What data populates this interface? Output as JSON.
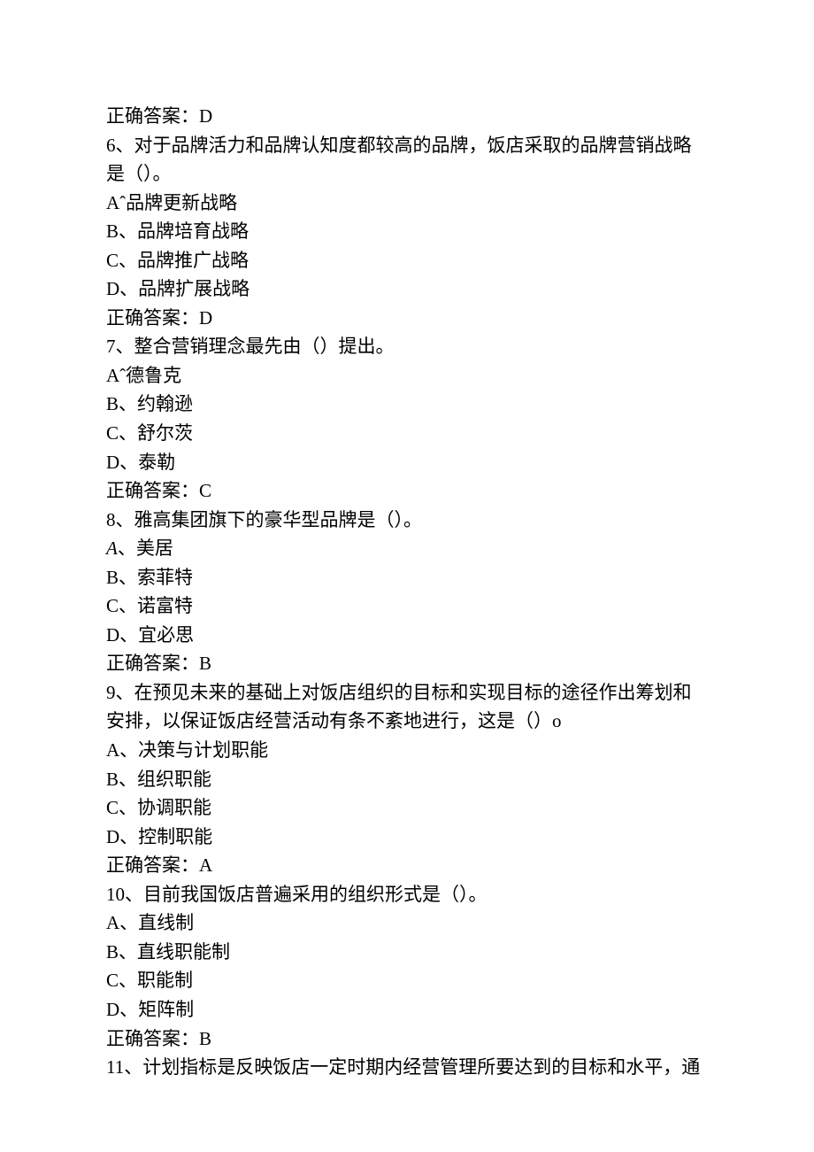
{
  "lines": {
    "l0": "正确答案：D",
    "l1": "6、对于品牌活力和品牌认知度都较高的品牌，饭店采取的品牌营销战略是（）。",
    "l2": "Aˆ品牌更新战略",
    "l3": "B、品牌培育战略",
    "l4": "C、品牌推广战略",
    "l5": "D、品牌扩展战略",
    "l6": "正确答案：D",
    "l7": "7、整合营销理念最先由（）提出。",
    "l8": "Aˆ德鲁克",
    "l9": "B、约翰逊",
    "l10": "C、舒尔茨",
    "l11": "D、泰勒",
    "l12": "正确答案：C",
    "l13": "8、雅高集团旗下的豪华型品牌是（）。",
    "l14a": "A",
    "l14b": "、美居",
    "l15": "B、索菲特",
    "l16": "C、诺富特",
    "l17": "D、宜必思",
    "l18": "正确答案：B",
    "l19": "9、在预见未来的基础上对饭店组织的目标和实现目标的途径作出筹划和安排，以保证饭店经营活动有条不紊地进行，这是（）o",
    "l20": "A、决策与计划职能",
    "l21": "B、组织职能",
    "l22": "C、协调职能",
    "l23": "D、控制职能",
    "l24": "正确答案：A",
    "l25": "10、目前我国饭店普遍采用的组织形式是（）。",
    "l26": "A、直线制",
    "l27": "B、直线职能制",
    "l28": "C、职能制",
    "l29": "D、矩阵制",
    "l30": "正确答案：B",
    "l31": "11、计划指标是反映饭店一定时期内经营管理所要达到的目标和水平，通"
  }
}
